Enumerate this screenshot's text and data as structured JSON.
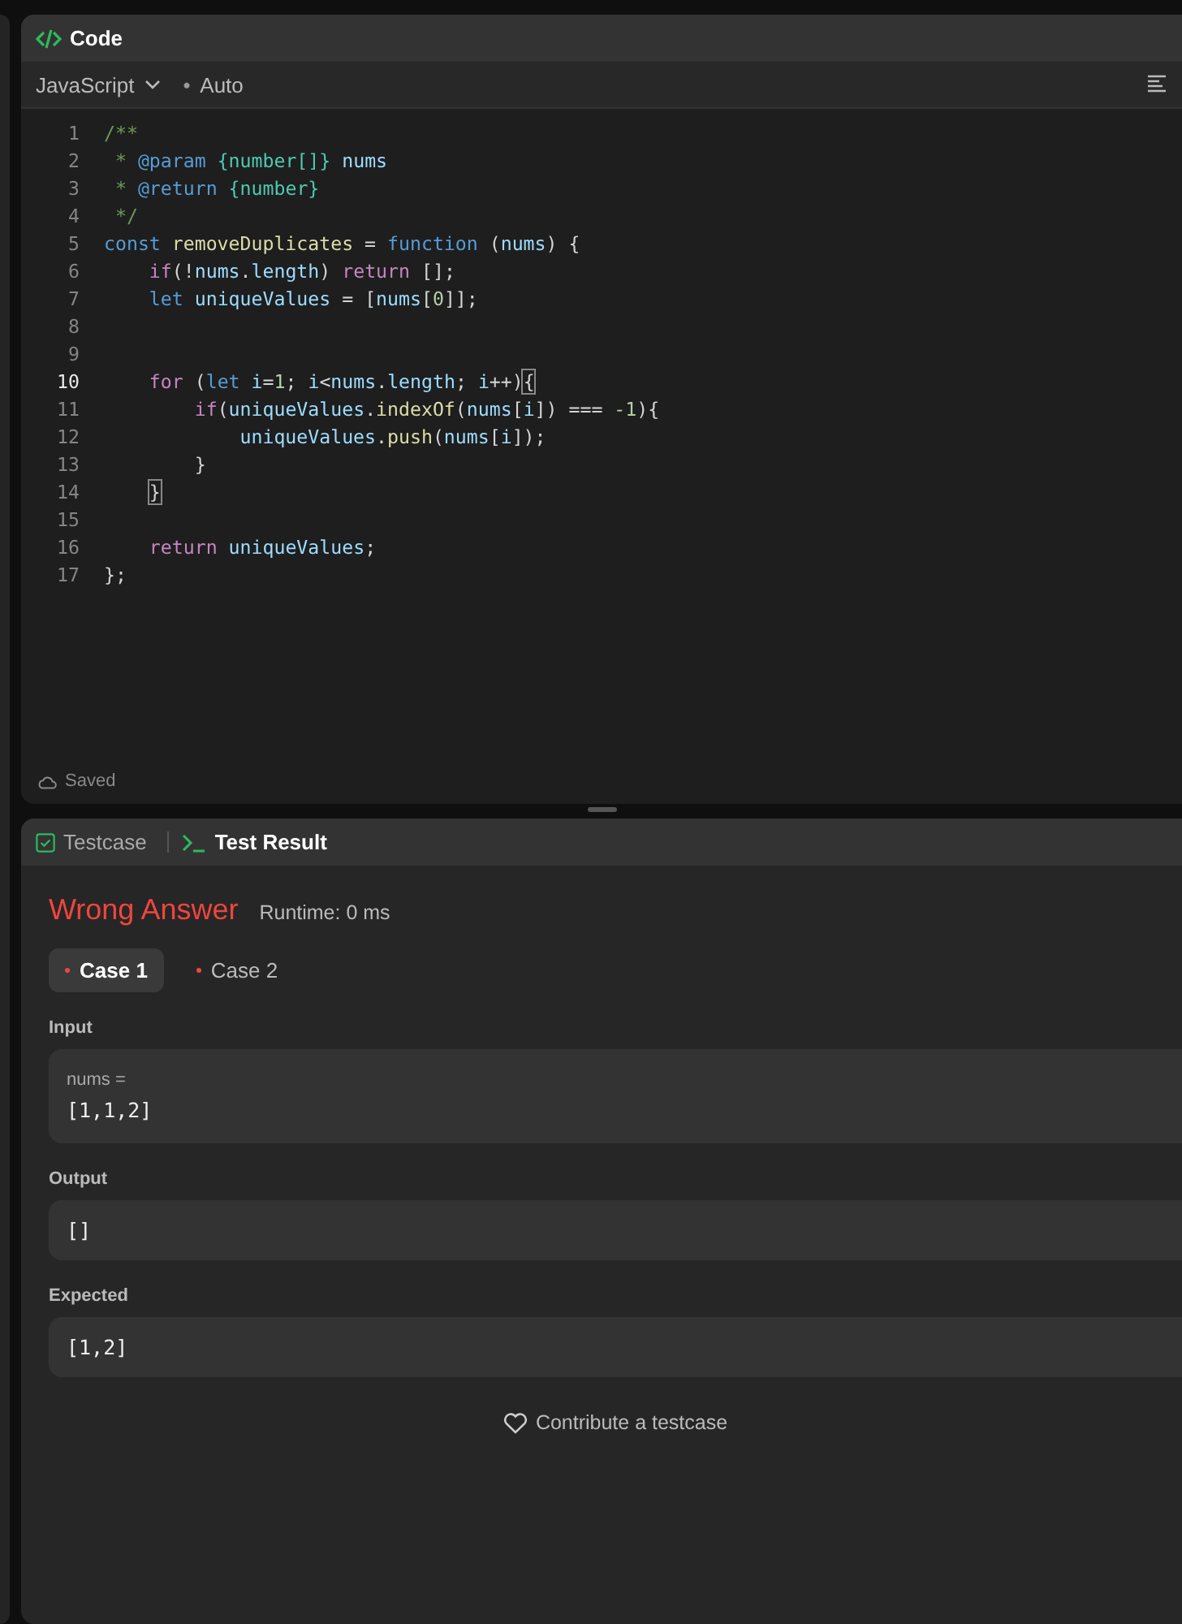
{
  "code_panel": {
    "title": "Code",
    "language": "JavaScript",
    "mode_marker": "•",
    "mode": "Auto",
    "status": "Saved",
    "lines": [
      {
        "number": "1",
        "current": false,
        "tokens": [
          {
            "text": "/**",
            "kind": "comment"
          }
        ]
      },
      {
        "number": "2",
        "current": false,
        "tokens": [
          {
            "text": " * ",
            "kind": "comment"
          },
          {
            "text": "@param",
            "kind": "keyword"
          },
          {
            "text": " {number[]}",
            "kind": "type"
          },
          {
            "text": " nums",
            "kind": "variable"
          }
        ]
      },
      {
        "number": "3",
        "current": false,
        "tokens": [
          {
            "text": " * ",
            "kind": "comment"
          },
          {
            "text": "@return",
            "kind": "keyword"
          },
          {
            "text": " {number}",
            "kind": "type"
          }
        ]
      },
      {
        "number": "4",
        "current": false,
        "tokens": [
          {
            "text": " */",
            "kind": "comment"
          }
        ]
      },
      {
        "number": "5",
        "current": false,
        "tokens": [
          {
            "text": "const",
            "kind": "keyword"
          },
          {
            "text": " removeDuplicates",
            "kind": "function"
          },
          {
            "text": " =",
            "kind": "plain"
          },
          {
            "text": " function",
            "kind": "keyword"
          },
          {
            "text": " (",
            "kind": "plain"
          },
          {
            "text": "nums",
            "kind": "variable"
          },
          {
            "text": ") {",
            "kind": "plain"
          }
        ]
      },
      {
        "number": "6",
        "current": false,
        "tokens": [
          {
            "text": "    if",
            "kind": "control"
          },
          {
            "text": "(!",
            "kind": "plain"
          },
          {
            "text": "nums",
            "kind": "variable"
          },
          {
            "text": ".",
            "kind": "plain"
          },
          {
            "text": "length",
            "kind": "variable"
          },
          {
            "text": ")",
            "kind": "plain"
          },
          {
            "text": " return",
            "kind": "control"
          },
          {
            "text": " [];",
            "kind": "plain"
          }
        ]
      },
      {
        "number": "7",
        "current": false,
        "tokens": [
          {
            "text": "    let",
            "kind": "keyword"
          },
          {
            "text": " uniqueValues",
            "kind": "variable"
          },
          {
            "text": " = [",
            "kind": "plain"
          },
          {
            "text": "nums",
            "kind": "variable"
          },
          {
            "text": "[",
            "kind": "plain"
          },
          {
            "text": "0",
            "kind": "number"
          },
          {
            "text": "]];",
            "kind": "plain"
          }
        ]
      },
      {
        "number": "8",
        "current": false
      },
      {
        "number": "9",
        "current": false
      },
      {
        "number": "10",
        "current": true,
        "tokens": [
          {
            "text": "    for",
            "kind": "control"
          },
          {
            "text": " (",
            "kind": "plain"
          },
          {
            "text": "let",
            "kind": "keyword"
          },
          {
            "text": " i",
            "kind": "variable"
          },
          {
            "text": "=",
            "kind": "plain"
          },
          {
            "text": "1",
            "kind": "number"
          },
          {
            "text": "; ",
            "kind": "plain"
          },
          {
            "text": "i",
            "kind": "variable"
          },
          {
            "text": "<",
            "kind": "plain"
          },
          {
            "text": "nums",
            "kind": "variable"
          },
          {
            "text": ".",
            "kind": "plain"
          },
          {
            "text": "length",
            "kind": "variable"
          },
          {
            "text": "; ",
            "kind": "plain"
          },
          {
            "text": "i",
            "kind": "variable"
          },
          {
            "text": "++)",
            "kind": "plain"
          },
          {
            "text": "{",
            "kind": "bracket-match"
          }
        ]
      },
      {
        "number": "11",
        "current": false,
        "tokens": [
          {
            "text": "        if",
            "kind": "control"
          },
          {
            "text": "(",
            "kind": "plain"
          },
          {
            "text": "uniqueValues",
            "kind": "variable"
          },
          {
            "text": ".",
            "kind": "plain"
          },
          {
            "text": "indexOf",
            "kind": "function"
          },
          {
            "text": "(",
            "kind": "plain"
          },
          {
            "text": "nums",
            "kind": "variable"
          },
          {
            "text": "[",
            "kind": "plain"
          },
          {
            "text": "i",
            "kind": "variable"
          },
          {
            "text": "]) === ",
            "kind": "plain"
          },
          {
            "text": "-1",
            "kind": "number"
          },
          {
            "text": "){",
            "kind": "plain"
          }
        ]
      },
      {
        "number": "12",
        "current": false,
        "tokens": [
          {
            "text": "            uniqueValues",
            "kind": "variable"
          },
          {
            "text": ".",
            "kind": "plain"
          },
          {
            "text": "push",
            "kind": "function"
          },
          {
            "text": "(",
            "kind": "plain"
          },
          {
            "text": "nums",
            "kind": "variable"
          },
          {
            "text": "[",
            "kind": "plain"
          },
          {
            "text": "i",
            "kind": "variable"
          },
          {
            "text": "]);",
            "kind": "plain"
          }
        ]
      },
      {
        "number": "13",
        "current": false,
        "tokens": [
          {
            "text": "        }",
            "kind": "plain"
          }
        ]
      },
      {
        "number": "14",
        "current": false,
        "tokens": [
          {
            "text": "    }",
            "kind": "bracket-match"
          }
        ]
      },
      {
        "number": "15",
        "current": false
      },
      {
        "number": "16",
        "current": false,
        "tokens": [
          {
            "text": "    return",
            "kind": "control"
          },
          {
            "text": " uniqueValues",
            "kind": "variable"
          },
          {
            "text": ";",
            "kind": "plain"
          }
        ]
      },
      {
        "number": "17",
        "current": false,
        "tokens": [
          {
            "text": "};",
            "kind": "plain"
          }
        ]
      }
    ]
  },
  "result_panel": {
    "tabs": [
      {
        "label": "Testcase",
        "kind": "check",
        "selected": false
      },
      {
        "label": "Test Result",
        "kind": "terminal",
        "selected": true
      }
    ],
    "verdict": "Wrong Answer",
    "accepted": false,
    "runtime": "Runtime: 0 ms",
    "cases": [
      {
        "label": "Case 1",
        "passed": false,
        "selected": true
      },
      {
        "label": "Case 2",
        "passed": false,
        "selected": false
      }
    ],
    "input_label": "Input",
    "input_name": "nums =",
    "input_value": "[1,1,2]",
    "output_label": "Output",
    "output_value": "[]",
    "expected_label": "Expected",
    "expected_value": "[1,2]",
    "contribute": "Contribute a testcase"
  }
}
